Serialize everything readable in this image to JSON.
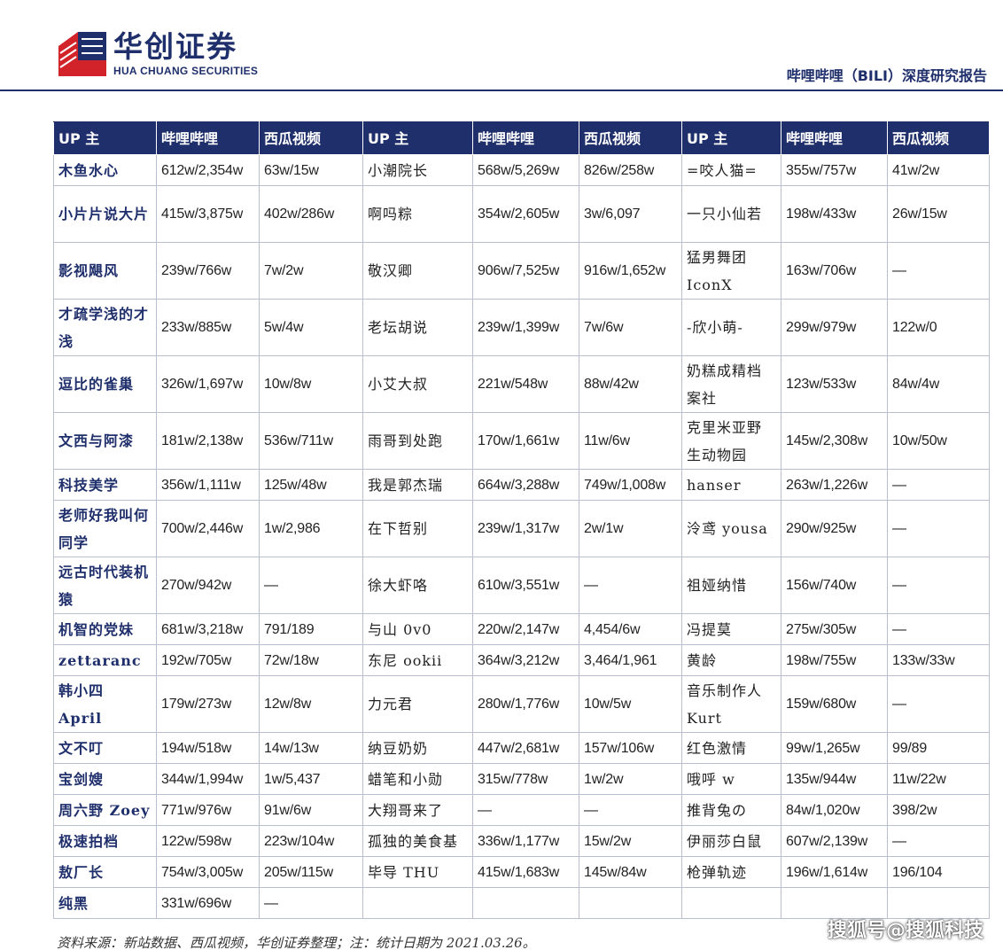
{
  "header": {
    "company_cn": "华创证券",
    "company_en": "HUA CHUANG SECURITIES",
    "report_title": "哔哩哔哩（BILI）深度研究报告",
    "brand_color": "#1f2f6b",
    "logo_icon": "hua-chuang-logo-icon"
  },
  "table": {
    "headers": [
      "UP 主",
      "哔哩哔哩",
      "西瓜视频",
      "UP 主",
      "哔哩哔哩",
      "西瓜视频",
      "UP 主",
      "哔哩哔哩",
      "西瓜视频"
    ],
    "rows": [
      [
        "木鱼水心",
        "612w/2,354w",
        "63w/15w",
        "小潮院长",
        "568w/5,269w",
        "826w/258w",
        "=咬人猫=",
        "355w/757w",
        "41w/2w"
      ],
      [
        "小片片说大片",
        "415w/3,875w",
        "402w/286w",
        "啊吗粽",
        "354w/2,605w",
        "3w/6,097",
        "一只小仙若",
        "198w/433w",
        "26w/15w"
      ],
      [
        "影视飓风",
        "239w/766w",
        "7w/2w",
        "敬汉卿",
        "906w/7,525w",
        "916w/1,652w",
        "猛男舞团 IconX",
        "163w/706w",
        "—"
      ],
      [
        "才疏学浅的才浅",
        "233w/885w",
        "5w/4w",
        "老坛胡说",
        "239w/1,399w",
        "7w/6w",
        "-欣小萌-",
        "299w/979w",
        "122w/0"
      ],
      [
        "逗比的雀巢",
        "326w/1,697w",
        "10w/8w",
        "小艾大叔",
        "221w/548w",
        "88w/42w",
        "奶糕成精档案社",
        "123w/533w",
        "84w/4w"
      ],
      [
        "文西与阿漆",
        "181w/2,138w",
        "536w/711w",
        "雨哥到处跑",
        "170w/1,661w",
        "11w/6w",
        "克里米亚野生动物园",
        "145w/2,308w",
        "10w/50w"
      ],
      [
        "科技美学",
        "356w/1,111w",
        "125w/48w",
        "我是郭杰瑞",
        "664w/3,288w",
        "749w/1,008w",
        "hanser",
        "263w/1,226w",
        "—"
      ],
      [
        "老师好我叫何同学",
        "700w/2,446w",
        "1w/2,986",
        "在下哲别",
        "239w/1,317w",
        "2w/1w",
        "泠鸢 yousa",
        "290w/925w",
        "—"
      ],
      [
        "远古时代装机猿",
        "270w/942w",
        "—",
        "徐大虾咯",
        "610w/3,551w",
        "—",
        "祖娅纳惜",
        "156w/740w",
        "—"
      ],
      [
        "机智的党妹",
        "681w/3,218w",
        "791/189",
        "与山 0v0",
        "220w/2,147w",
        "4,454/6w",
        "冯提莫",
        "275w/305w",
        "—"
      ],
      [
        "zettaranc",
        "192w/705w",
        "72w/18w",
        "东尼 ookii",
        "364w/3,212w",
        "3,464/1,961",
        "黄龄",
        "198w/755w",
        "133w/33w"
      ],
      [
        "韩小四 April",
        "179w/273w",
        "12w/8w",
        "力元君",
        "280w/1,776w",
        "10w/5w",
        "音乐制作人 Kurt",
        "159w/680w",
        "—"
      ],
      [
        "文不叮",
        "194w/518w",
        "14w/13w",
        "纳豆奶奶",
        "447w/2,681w",
        "157w/106w",
        "红色激情",
        "99w/1,265w",
        "99/89"
      ],
      [
        "宝剑嫂",
        "344w/1,994w",
        "1w/5,437",
        "蜡笔和小勋",
        "315w/778w",
        "1w/2w",
        "哦呼 w",
        "135w/944w",
        "11w/22w"
      ],
      [
        "周六野 Zoey",
        "771w/976w",
        "91w/6w",
        "大翔哥来了",
        "—",
        "—",
        "推背兔の",
        "84w/1,020w",
        "398/2w"
      ],
      [
        "极速拍档",
        "122w/598w",
        "223w/104w",
        "孤独的美食基",
        "336w/1,177w",
        "15w/2w",
        "伊丽莎白鼠",
        "607w/2,139w",
        "—"
      ],
      [
        "敖厂长",
        "754w/3,005w",
        "205w/115w",
        "毕导 THU",
        "415w/1,683w",
        "145w/84w",
        "枪弹轨迹",
        "196w/1,614w",
        "196/104"
      ],
      [
        "纯黑",
        "331w/696w",
        "—",
        "",
        "",
        "",
        "",
        "",
        ""
      ]
    ],
    "tall_rows": [
      1,
      2,
      3,
      4,
      5,
      7,
      8,
      11
    ]
  },
  "footer": {
    "source": "资料来源：新站数据、西瓜视频，华创证券整理；注：统计日期为 2021.03.26。",
    "watermark": "搜狐号@搜狐科技"
  }
}
